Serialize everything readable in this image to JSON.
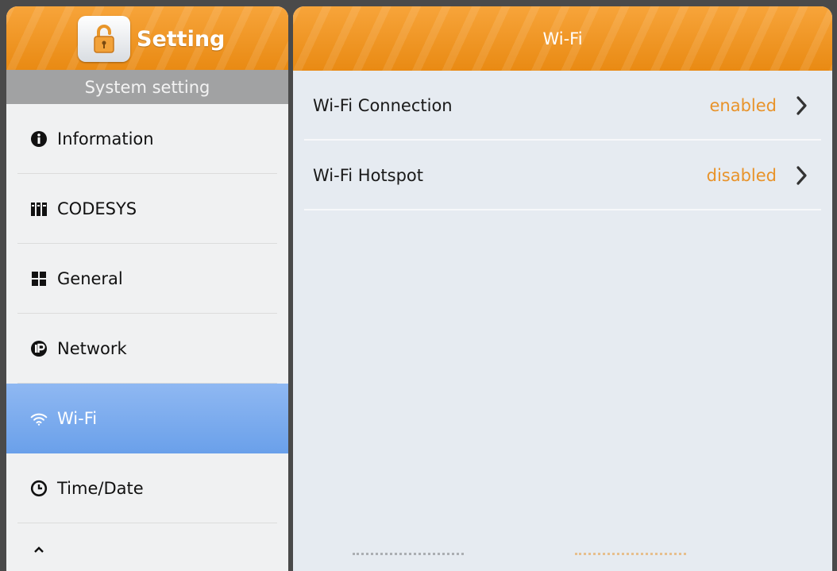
{
  "app": {
    "title": "Setting",
    "icon": "unlock-icon"
  },
  "sidebar": {
    "section_label": "System setting",
    "items": [
      {
        "label": "Information",
        "icon": "info-icon"
      },
      {
        "label": "CODESYS",
        "icon": "codesys-icon"
      },
      {
        "label": "General",
        "icon": "grid-icon"
      },
      {
        "label": "Network",
        "icon": "ip-icon"
      },
      {
        "label": "Wi-Fi",
        "icon": "wifi-icon",
        "selected": true
      },
      {
        "label": "Time/Date",
        "icon": "clock-icon"
      },
      {
        "label": "",
        "icon": "chevron-up-icon"
      }
    ]
  },
  "main": {
    "title": "Wi-Fi",
    "rows": [
      {
        "label": "Wi-Fi Connection",
        "value": "enabled"
      },
      {
        "label": "Wi-Fi Hotspot",
        "value": "disabled"
      }
    ]
  },
  "colors": {
    "header_orange": "#ef9620",
    "value_orange": "#e8932a",
    "selected_blue": "#7aabee",
    "section_gray": "#a1a2a3"
  }
}
